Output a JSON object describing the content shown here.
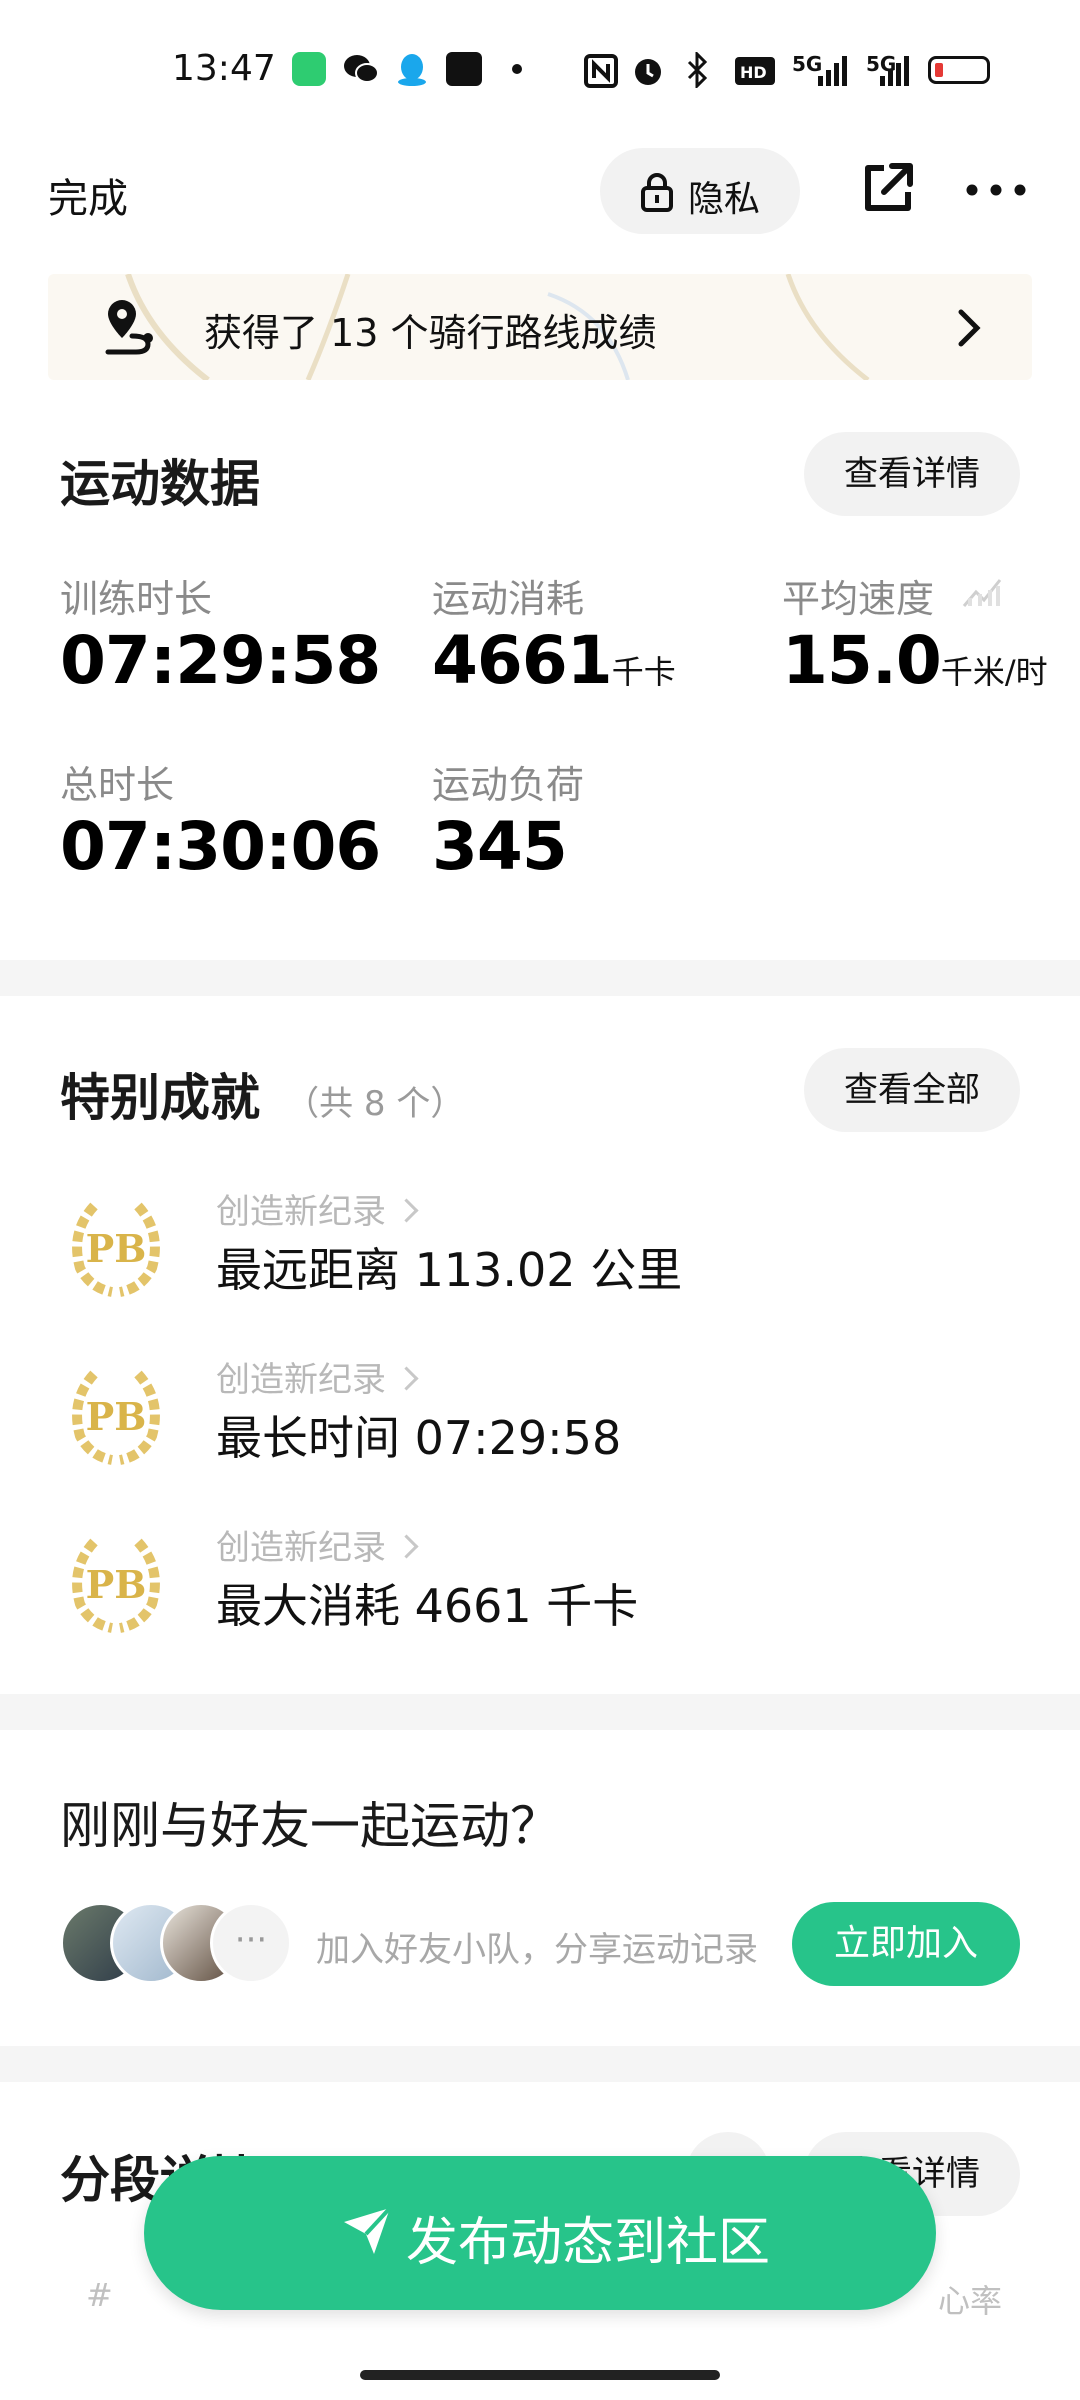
{
  "status_bar": {
    "time": "13:47",
    "network": "5G"
  },
  "topbar": {
    "done_label": "完成",
    "privacy_label": "隐私"
  },
  "route_banner": {
    "text": "获得了 13 个骑行路线成绩"
  },
  "sport_data": {
    "title": "运动数据",
    "details_label": "查看详情",
    "stats": [
      {
        "label": "训练时长",
        "value": "07:29:58",
        "unit": ""
      },
      {
        "label": "运动消耗",
        "value": "4661",
        "unit": "千卡"
      },
      {
        "label": "平均速度",
        "value": "15.0",
        "unit": "千米/时"
      },
      {
        "label": "总时长",
        "value": "07:30:06",
        "unit": ""
      },
      {
        "label": "运动负荷",
        "value": "345",
        "unit": ""
      }
    ]
  },
  "achievements": {
    "title": "特别成就",
    "count": "（共 8 个）",
    "view_all_label": "查看全部",
    "items": [
      {
        "badge": "PB",
        "sub": "创造新纪录",
        "main": "最远距离 113.02 公里"
      },
      {
        "badge": "PB",
        "sub": "创造新纪录",
        "main": "最长时间 07:29:58"
      },
      {
        "badge": "PB",
        "sub": "创造新纪录",
        "main": "最大消耗 4661 千卡"
      }
    ]
  },
  "friends": {
    "title": "刚刚与好友一起运动？",
    "desc": "加入好友小队，分享运动记录",
    "join_label": "立即加入",
    "more_label": "···"
  },
  "segments": {
    "title": "分段详情",
    "details_label": "查看详情",
    "col_index": "#",
    "col_heart": "心率"
  },
  "publish": {
    "label": "发布动态到社区"
  },
  "colors": {
    "accent": "#27c48a",
    "badge_gold": "#d9b44a"
  }
}
